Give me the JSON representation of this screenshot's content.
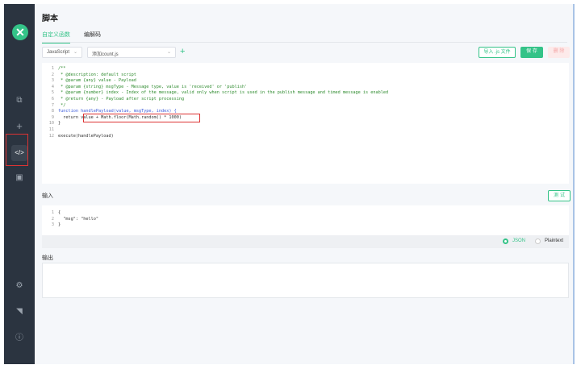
{
  "sidebar": {
    "logo": "✕",
    "items": [
      {
        "name": "connections",
        "icon": "⧉"
      },
      {
        "name": "new",
        "icon": "+"
      },
      {
        "name": "script",
        "icon": "</>"
      },
      {
        "name": "log",
        "icon": "▣"
      }
    ],
    "bottom": [
      {
        "name": "settings",
        "icon": "⚙"
      },
      {
        "name": "subscribe",
        "icon": "◥"
      },
      {
        "name": "about",
        "icon": "ⓘ"
      }
    ]
  },
  "header": {
    "title": "脚本"
  },
  "tabs": [
    {
      "label": "自定义函数"
    },
    {
      "label": "编解码"
    }
  ],
  "toolbar": {
    "language": "JavaScript",
    "script_name": "添加count.js",
    "import_label": "导入 .js 文件",
    "save_label": "保 存",
    "delete_label": "删 除"
  },
  "editor": {
    "lines": [
      {
        "n": "1",
        "text": "/**",
        "cls": "cm"
      },
      {
        "n": "2",
        "text": " * @description: default script",
        "cls": "cm"
      },
      {
        "n": "3",
        "text": " * @param {any} value - Payload",
        "cls": "cm"
      },
      {
        "n": "4",
        "text": " * @param {string} msgType - Message type, value is 'received' or 'publish'",
        "cls": "cm"
      },
      {
        "n": "5",
        "text": " * @param {number} index - Index of the message, valid only when script is used in the publish message and timed message is enabled",
        "cls": "cm"
      },
      {
        "n": "6",
        "text": " * @return {any} - Payload after script processing",
        "cls": "cm"
      },
      {
        "n": "7",
        "text": " */",
        "cls": "cm"
      },
      {
        "n": "8",
        "text": "function handlePayload(value, msgType, index) {",
        "cls": "kw"
      },
      {
        "n": "9",
        "text": "  return value + Math.floor(Math.random() * 1000)",
        "cls": ""
      },
      {
        "n": "10",
        "text": "}",
        "cls": ""
      },
      {
        "n": "11",
        "text": "",
        "cls": ""
      },
      {
        "n": "12",
        "text": "execute(handlePayload)",
        "cls": ""
      }
    ]
  },
  "input": {
    "label": "输入",
    "test_label": "测 试",
    "lines": [
      {
        "n": "1",
        "text": "{"
      },
      {
        "n": "2",
        "text": "  \"msg\": \"hello\""
      },
      {
        "n": "3",
        "text": "}"
      }
    ],
    "formats": [
      {
        "label": "JSON",
        "selected": true
      },
      {
        "label": "Plaintext",
        "selected": false
      }
    ]
  },
  "output": {
    "label": "输出"
  }
}
